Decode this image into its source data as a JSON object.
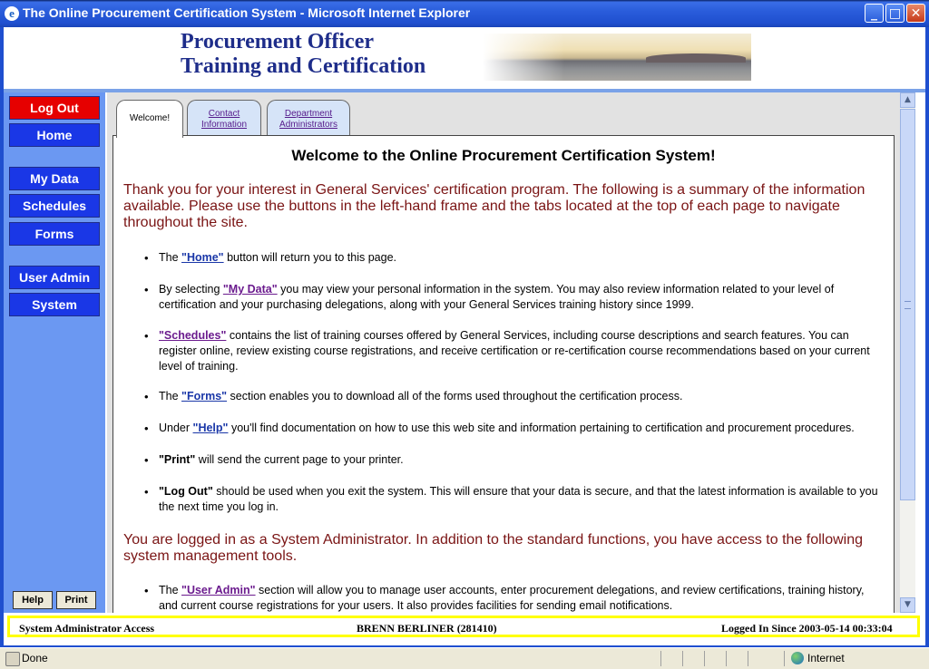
{
  "window": {
    "title": "The Online Procurement Certification System - Microsoft Internet Explorer",
    "minimize": "_",
    "maximize": "□",
    "close": "✕"
  },
  "banner": {
    "line1": "Procurement Officer",
    "line2": "Training and Certification"
  },
  "nav": {
    "logout": "Log Out",
    "home": "Home",
    "my_data": "My Data",
    "schedules": "Schedules",
    "forms": "Forms",
    "user_admin": "User Admin",
    "system": "System",
    "help": "Help",
    "print": "Print"
  },
  "tabs": {
    "welcome": "Welcome!",
    "contact_1": "Contact",
    "contact_2": "Information",
    "dept_1": "Department",
    "dept_2": "Administrators"
  },
  "content": {
    "heading": "Welcome to the Online Procurement Certification System!",
    "intro": "Thank you for your interest in General Services' certification program. The following is a summary of the information available. Please use the buttons in the left-hand frame and the tabs located at the top of each page to navigate throughout the site.",
    "b1": {
      "pre": "The ",
      "link": "\"Home\"",
      "post": " button will return you to this page."
    },
    "b2": {
      "pre": "By selecting ",
      "link": "\"My Data\"",
      "post": " you may view your personal information in the system. You may also review information related to your level of certification and your purchasing delegations, along with your General Services training history since 1999."
    },
    "b3": {
      "link": "\"Schedules\"",
      "post": " contains the list of training courses offered by General Services, including course descriptions and search features. You can register online, review existing course registrations, and receive certification or re-certification course recommendations based on your current level of training."
    },
    "b4": {
      "pre": "The ",
      "link": "\"Forms\"",
      "post": " section enables you to download all of the forms used throughout the certification process."
    },
    "b5": {
      "pre": "Under ",
      "link": "\"Help\"",
      "post": " you'll find documentation on how to use this web site and information pertaining to certification and procurement procedures."
    },
    "b6": {
      "bold": "\"Print\"",
      "post": " will send the current page to your printer."
    },
    "b7": {
      "bold": "\"Log Out\"",
      "post": " should be used when you exit the system. This will ensure that your data is secure, and that the latest information is available to you the next time you log in."
    },
    "admin_intro": "You are logged in as a System Administrator. In addition to the standard functions, you have access to the following system management tools.",
    "b8": {
      "pre": "The ",
      "link": "\"User Admin\"",
      "post": " section will allow you to manage user accounts, enter procurement delegations, and review certifications, training history, and current course registrations for your users. It also provides facilities for sending email notifications."
    }
  },
  "footer": {
    "access": "System Administrator Access",
    "user": "BRENN BERLINER (281410)",
    "logged_in": "Logged In Since 2003-05-14 00:33:04"
  },
  "statusbar": {
    "status": "Done",
    "zone": "Internet"
  },
  "colors": {
    "nav_blue": "#1a37e6",
    "logout_red": "#e60000",
    "intro_text": "#7a1414",
    "footer_border": "#ffff00"
  }
}
